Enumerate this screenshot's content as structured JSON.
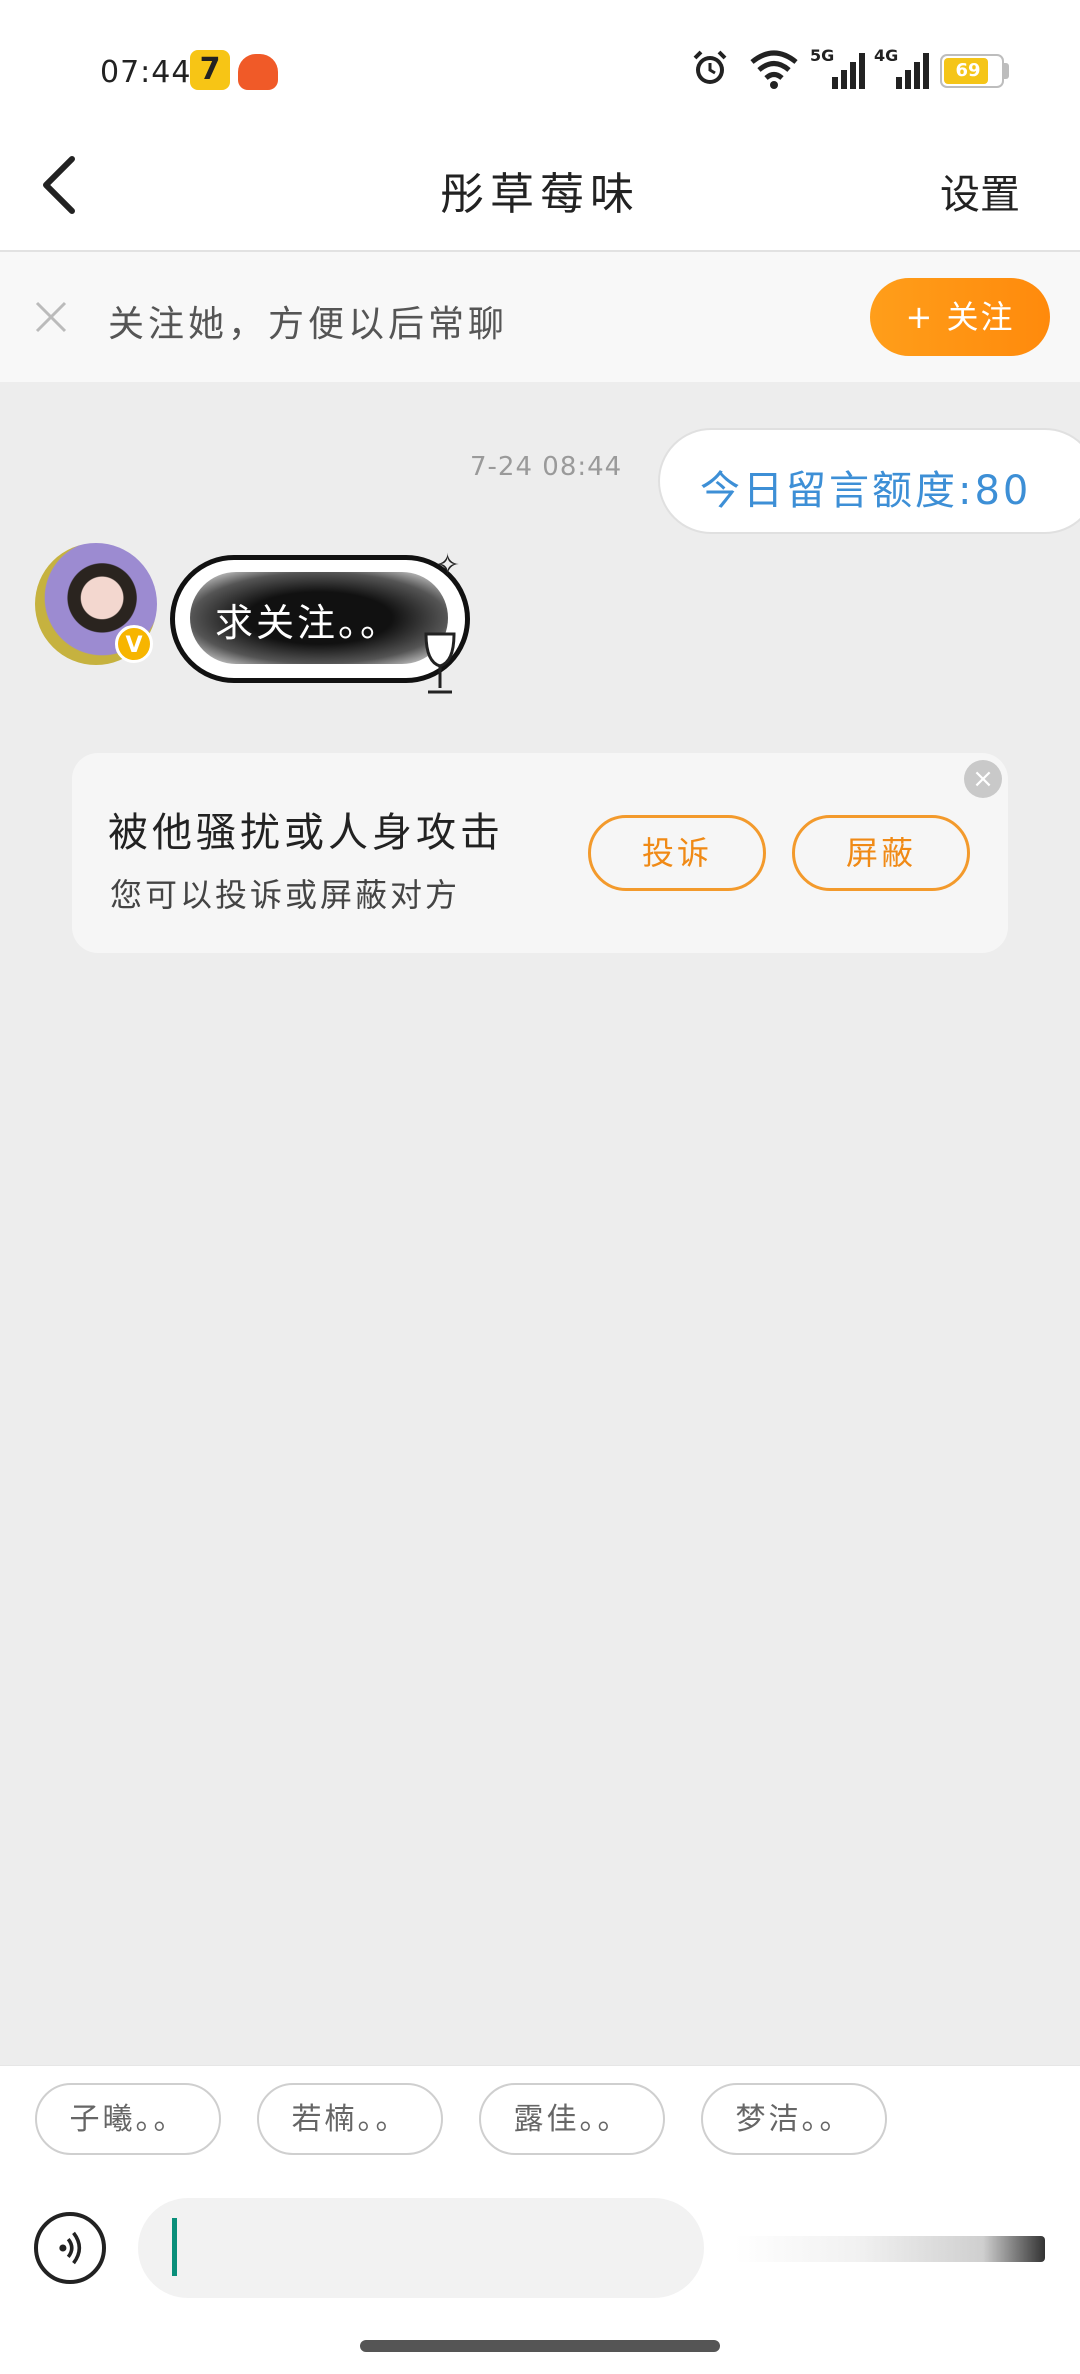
{
  "status_bar": {
    "time": "07:44",
    "battery": "69",
    "signal_labels": [
      "5G",
      "4G"
    ],
    "icons": [
      "app-icon-7",
      "app-icon-red",
      "alarm-icon",
      "wifi-icon",
      "signal-5g-icon",
      "signal-4g-icon",
      "battery-icon"
    ]
  },
  "header": {
    "title": "彤草莓味",
    "settings_label": "设置"
  },
  "follow_banner": {
    "text": "关注她，方便以后常聊",
    "button_label": "+ 关注"
  },
  "messages": {
    "time": "7-24 08:44",
    "quota": "今日留言额度:80",
    "received_text": "求关注。。",
    "verified_badge": "V"
  },
  "report_card": {
    "title": "被他骚扰或人身攻击",
    "subtitle": "您可以投诉或屏蔽对方",
    "report_label": "投诉",
    "block_label": "屏蔽"
  },
  "quick_replies": [
    "子曦。。",
    "若楠。。",
    "露佳。。",
    "梦洁。。"
  ],
  "colors": {
    "accent_orange": "#ff9514",
    "quota_blue": "#3d8fd6",
    "caret_teal": "#0a8f7a",
    "background": "#ededed"
  }
}
